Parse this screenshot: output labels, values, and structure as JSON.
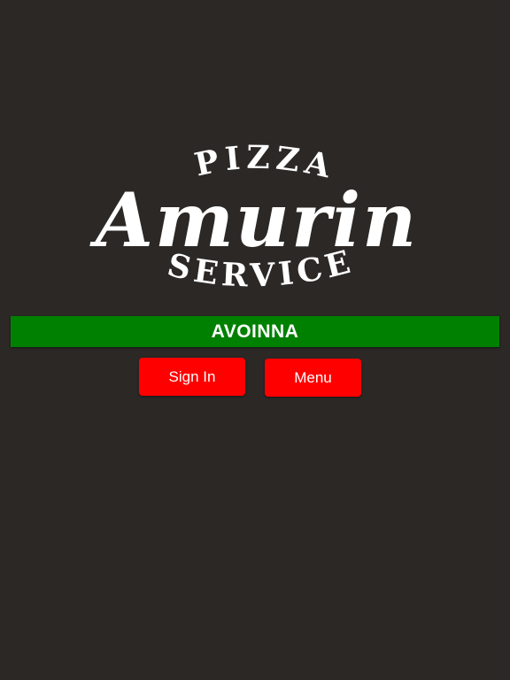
{
  "logo": {
    "top_text": "PIZZA",
    "main_text": "Amurin",
    "bottom_text": "SERVICE"
  },
  "store": {
    "name": "AVOINNA"
  },
  "buttons": {
    "sign_in_label": "Sign In",
    "menu_label": "Menu"
  },
  "colors": {
    "background": "#2b2826",
    "status_bar": "#008000",
    "button": "#ff0000",
    "text": "#ffffff"
  }
}
